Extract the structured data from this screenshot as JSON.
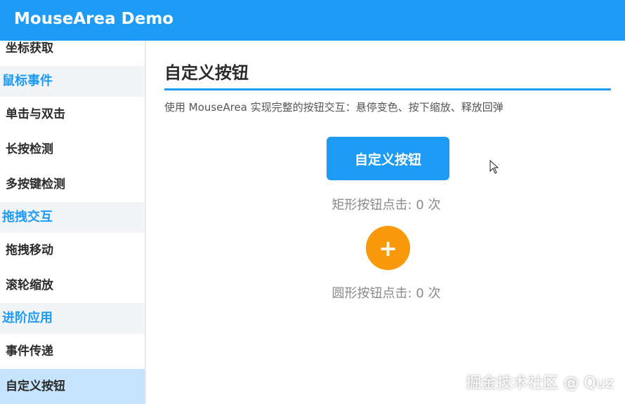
{
  "window": {
    "title": "MouseArea Demo"
  },
  "sidebar": {
    "items": [
      {
        "type": "item",
        "label": "坐标获取"
      },
      {
        "type": "group",
        "label": "鼠标事件"
      },
      {
        "type": "item",
        "label": "单击与双击"
      },
      {
        "type": "item",
        "label": "长按检测"
      },
      {
        "type": "item",
        "label": "多按键检测"
      },
      {
        "type": "group",
        "label": "拖拽交互"
      },
      {
        "type": "item",
        "label": "拖拽移动"
      },
      {
        "type": "item",
        "label": "滚轮缩放"
      },
      {
        "type": "group",
        "label": "进阶应用"
      },
      {
        "type": "item",
        "label": "事件传递"
      },
      {
        "type": "item",
        "label": "自定义按钮",
        "active": true
      }
    ]
  },
  "main": {
    "title": "自定义按钮",
    "description": "使用 MouseArea 实现完整的按钮交互：悬停变色、按下缩放、释放回弹",
    "rect_button": {
      "label": "自定义按钮",
      "count_text": "矩形按钮点击: 0 次"
    },
    "circle_button": {
      "label": "+",
      "count_text": "圆形按钮点击: 0 次"
    }
  },
  "watermark": "掘金技术社区 @ Quz",
  "colors": {
    "accent": "#1e9bf5",
    "circle": "#f8990a",
    "active_bg": "#c6e4fd",
    "group_bg": "#f2f4f8"
  }
}
